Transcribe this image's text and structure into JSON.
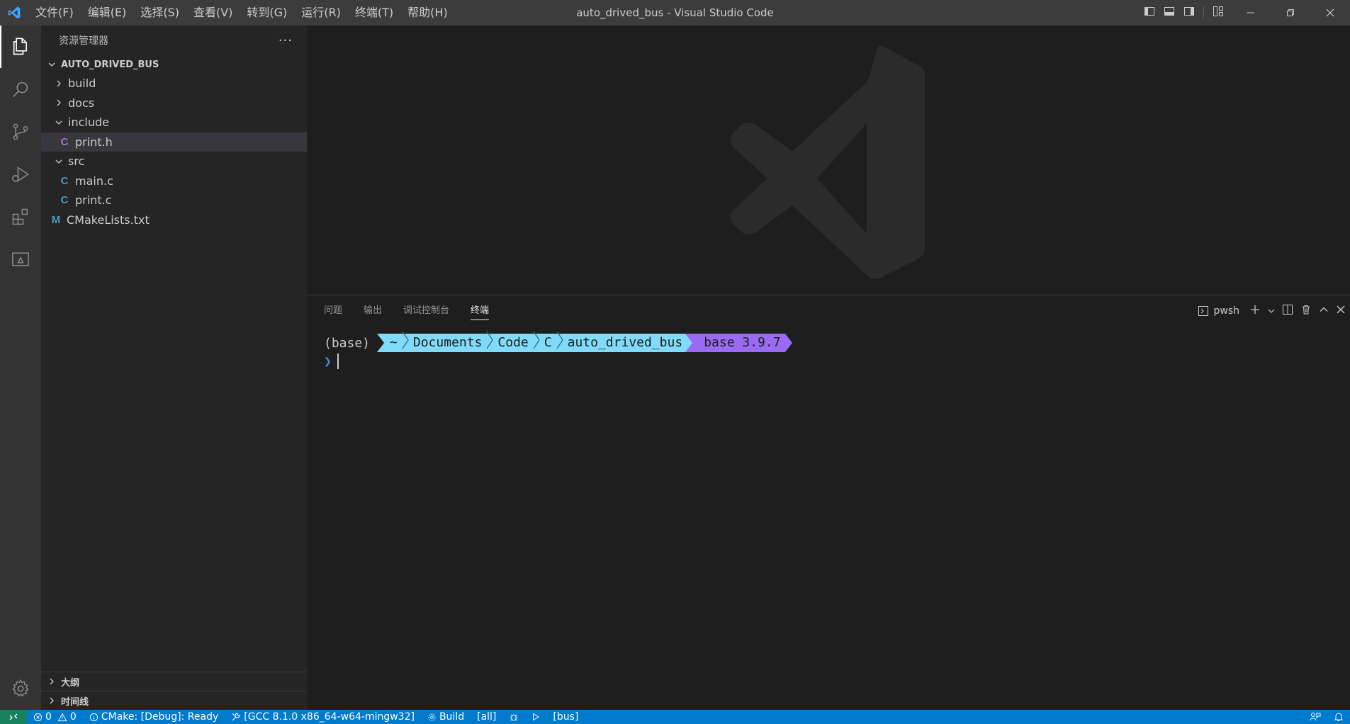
{
  "window": {
    "title": "auto_drived_bus - Visual Studio Code",
    "menu": [
      "文件(F)",
      "编辑(E)",
      "选择(S)",
      "查看(V)",
      "转到(G)",
      "运行(R)",
      "终端(T)",
      "帮助(H)"
    ]
  },
  "activity_bar": {
    "items": [
      "explorer-icon",
      "search-icon",
      "source-control-icon",
      "run-debug-icon",
      "extensions-icon",
      "remote-explorer-icon"
    ],
    "bottom": [
      "gear-icon"
    ]
  },
  "sidebar": {
    "header": "资源管理器",
    "more": "···",
    "folder": "AUTO_DRIVED_BUS",
    "tree": [
      {
        "label": "build",
        "type": "folder",
        "expanded": false,
        "indent": 0
      },
      {
        "label": "docs",
        "type": "folder",
        "expanded": false,
        "indent": 0
      },
      {
        "label": "include",
        "type": "folder",
        "expanded": true,
        "indent": 0
      },
      {
        "label": "print.h",
        "type": "file",
        "badge": "C",
        "indent": 1,
        "selected": true
      },
      {
        "label": "src",
        "type": "folder",
        "expanded": true,
        "indent": 0
      },
      {
        "label": "main.c",
        "type": "file",
        "badge": "C",
        "indent": 1
      },
      {
        "label": "print.c",
        "type": "file",
        "badge": "C",
        "indent": 1
      },
      {
        "label": "CMakeLists.txt",
        "type": "file",
        "badge": "M",
        "indent": 0
      }
    ],
    "sections": [
      "大纲",
      "时间线"
    ]
  },
  "panel": {
    "tabs": [
      "问题",
      "输出",
      "调试控制台",
      "终端"
    ],
    "active_tab": "终端",
    "terminal_name": "pwsh",
    "prompt": {
      "env": "(base)",
      "path": [
        "~",
        "Documents",
        "Code",
        "C",
        "auto_drived_bus"
      ],
      "conda": "base 3.9.7",
      "conda_glyph": "",
      "input_marker": "❯"
    }
  },
  "status_bar": {
    "errors": "0",
    "warnings": "0",
    "cmake": "CMake: [Debug]: Ready",
    "kit": "[GCC 8.1.0 x86_64-w64-mingw32]",
    "build": "Build",
    "target": "[all]",
    "launch_target": "[bus]"
  },
  "colors": {
    "accent": "#007acc",
    "remote": "#16825d",
    "prompt_blue": "#7fdbf7",
    "prompt_purple": "#9a6bf2"
  }
}
